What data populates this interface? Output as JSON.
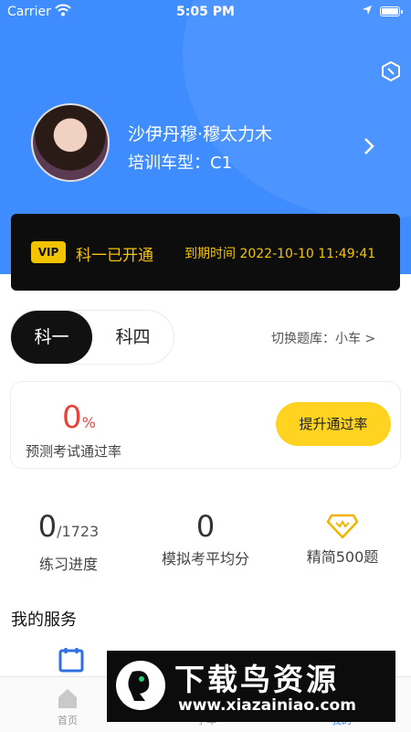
{
  "status_bar": {
    "carrier": "Carrier",
    "time": "5:05 PM"
  },
  "profile": {
    "name": "沙伊丹穆·穆太力木",
    "car_type": "培训车型：C1"
  },
  "vip": {
    "badge": "VIP",
    "status": "科一已开通",
    "expire": "到期时间 2022-10-10 11:49:41"
  },
  "subjects": {
    "active": "科一",
    "inactive": "科四",
    "switch_bank": "切换题库：小车 >"
  },
  "pass_card": {
    "rate_value": "0",
    "rate_unit": "%",
    "label": "预测考试通过率",
    "button": "提升通过率"
  },
  "stats": [
    {
      "value": "0",
      "suffix": "/1723",
      "label": "练习进度"
    },
    {
      "value": "0",
      "label": "模拟考平均分"
    },
    {
      "icon": "diamond-icon",
      "label": "精简500题"
    }
  ],
  "services": {
    "title": "我的服务"
  },
  "tabbar": {
    "items": [
      {
        "label": "首页",
        "icon": "home-icon"
      },
      {
        "label": "",
        "icon": "tab-2-icon"
      },
      {
        "label": "学车",
        "icon": "learn-car-icon"
      },
      {
        "label": "我的",
        "icon": "profile-icon"
      }
    ]
  },
  "watermark": {
    "title": "下载鸟资源",
    "url": "www.xiazainiao.com"
  },
  "colors": {
    "header_blue": "#3f8cff",
    "vip_gold": "#f5c400",
    "accent_red": "#e8413a",
    "button_yellow": "#ffd320"
  }
}
